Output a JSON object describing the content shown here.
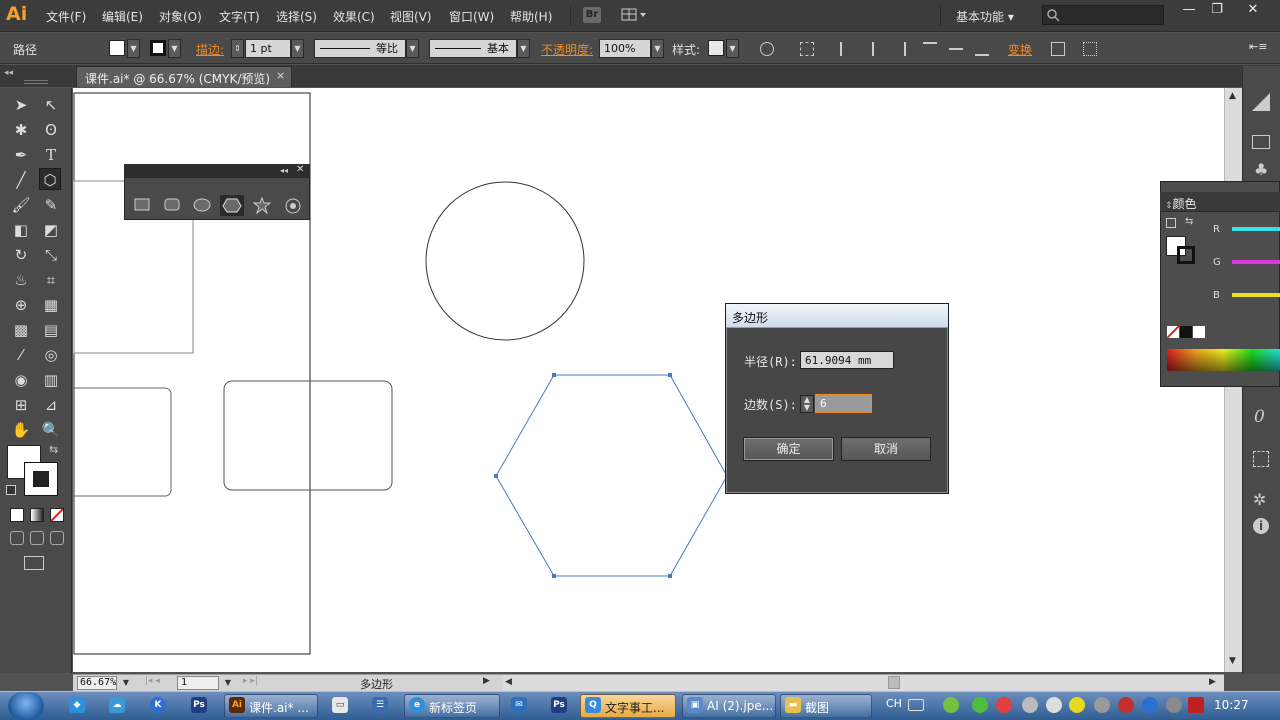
{
  "app": {
    "logo": "Ai",
    "menus": [
      "文件(F)",
      "编辑(E)",
      "对象(O)",
      "文字(T)",
      "选择(S)",
      "效果(C)",
      "视图(V)",
      "窗口(W)",
      "帮助(H)"
    ],
    "bridge_label": "Br",
    "workspace": "基本功能 ▾",
    "search_placeholder": "",
    "window_buttons": [
      "—",
      "❐",
      "✕"
    ]
  },
  "control_bar": {
    "selection_label": "路径",
    "stroke_label": "描边:",
    "stroke_weight": "1 pt",
    "stroke_profile": "等比",
    "brush": "基本",
    "opacity_label": "不透明度:",
    "opacity_value": "100%",
    "style_label": "样式:",
    "transform_label": "变换"
  },
  "document_tab": {
    "title": "课件.ai* @ 66.67% (CMYK/预览)",
    "close": "×"
  },
  "status_bar": {
    "zoom": "66.67%",
    "artboard": "1",
    "current_tool": "多边形"
  },
  "polygon_dialog": {
    "title": "多边形",
    "radius_label": "半径(R):",
    "radius_value": "61.9094 mm",
    "sides_label": "边数(S):",
    "sides_value": "6",
    "ok_label": "确定",
    "cancel_label": "取消"
  },
  "color_panel": {
    "title": "颜色",
    "channels": [
      "R",
      "G",
      "B"
    ],
    "channel_colors": [
      "#3ae0e6",
      "#e034e0",
      "#e8e020"
    ]
  },
  "taskbar": {
    "tasks": [
      {
        "label": "课件.ai* ...",
        "active": false,
        "icon": "Ai"
      },
      {
        "label": "新标签页",
        "active": false,
        "icon": "e"
      },
      {
        "label": "文字事工...",
        "active": true,
        "icon": "Q"
      },
      {
        "label": "AI (2).jpe...",
        "active": false,
        "icon": "img"
      },
      {
        "label": "截图",
        "active": false,
        "icon": "fd"
      }
    ],
    "lang": "CH",
    "clock": "10:27"
  }
}
